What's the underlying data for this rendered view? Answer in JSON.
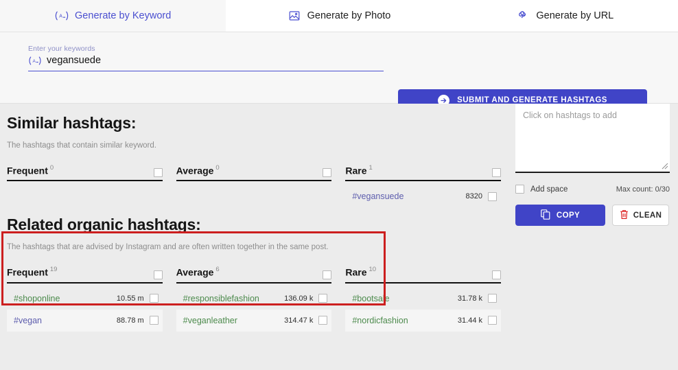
{
  "tabs": [
    {
      "label": "Generate by Keyword",
      "icon": "keyword-icon",
      "active": true
    },
    {
      "label": "Generate by Photo",
      "icon": "photo-icon",
      "active": false
    },
    {
      "label": "Generate by URL",
      "icon": "link-icon",
      "active": false
    }
  ],
  "form": {
    "keyword_label": "Enter your keywords",
    "keyword_value": "vegansuede",
    "keyword_icon": "keyword-icon",
    "submit_label": "SUBMIT AND GENERATE HASHTAGS",
    "submit_icon": "arrow-right-icon"
  },
  "similar": {
    "title": "Similar hashtags:",
    "subtitle": "The hashtags that contain similar keyword.",
    "columns": [
      {
        "label": "Frequent",
        "count": "0",
        "tags": []
      },
      {
        "label": "Average",
        "count": "0",
        "tags": []
      },
      {
        "label": "Rare",
        "count": "1",
        "tags": [
          {
            "name": "#vegansuede",
            "count": "8320",
            "color": "purple"
          }
        ]
      }
    ]
  },
  "related": {
    "title": "Related organic hashtags:",
    "subtitle": "The hashtags that are advised by Instagram and are often written together in the same post.",
    "highlighted": true,
    "highlight_color": "#cc1f1f",
    "columns": [
      {
        "label": "Frequent",
        "count": "19",
        "tags": [
          {
            "name": "#shoponline",
            "count": "10.55 m",
            "color": "green"
          },
          {
            "name": "#vegan",
            "count": "88.78 m",
            "color": "purple"
          }
        ]
      },
      {
        "label": "Average",
        "count": "6",
        "tags": [
          {
            "name": "#responsiblefashion",
            "count": "136.09 k",
            "color": "green"
          },
          {
            "name": "#veganleather",
            "count": "314.47 k",
            "color": "green"
          }
        ]
      },
      {
        "label": "Rare",
        "count": "10",
        "tags": [
          {
            "name": "#bootsale",
            "count": "31.78 k",
            "color": "green"
          },
          {
            "name": "#nordicfashion",
            "count": "31.44 k",
            "color": "green"
          }
        ]
      }
    ]
  },
  "panel": {
    "textarea_value": "",
    "textarea_placeholder": "Click on hashtags to add",
    "add_space_label": "Add space",
    "max_count_label": "Max count: 0/30",
    "copy_label": "COPY",
    "copy_icon": "copy-icon",
    "clean_label": "CLEAN",
    "clean_icon": "trash-icon"
  },
  "colors": {
    "accent": "#4044c7",
    "tag_green": "#4c8a4c",
    "tag_purple": "#5d5dad",
    "highlight_red": "#cc1f1f"
  }
}
